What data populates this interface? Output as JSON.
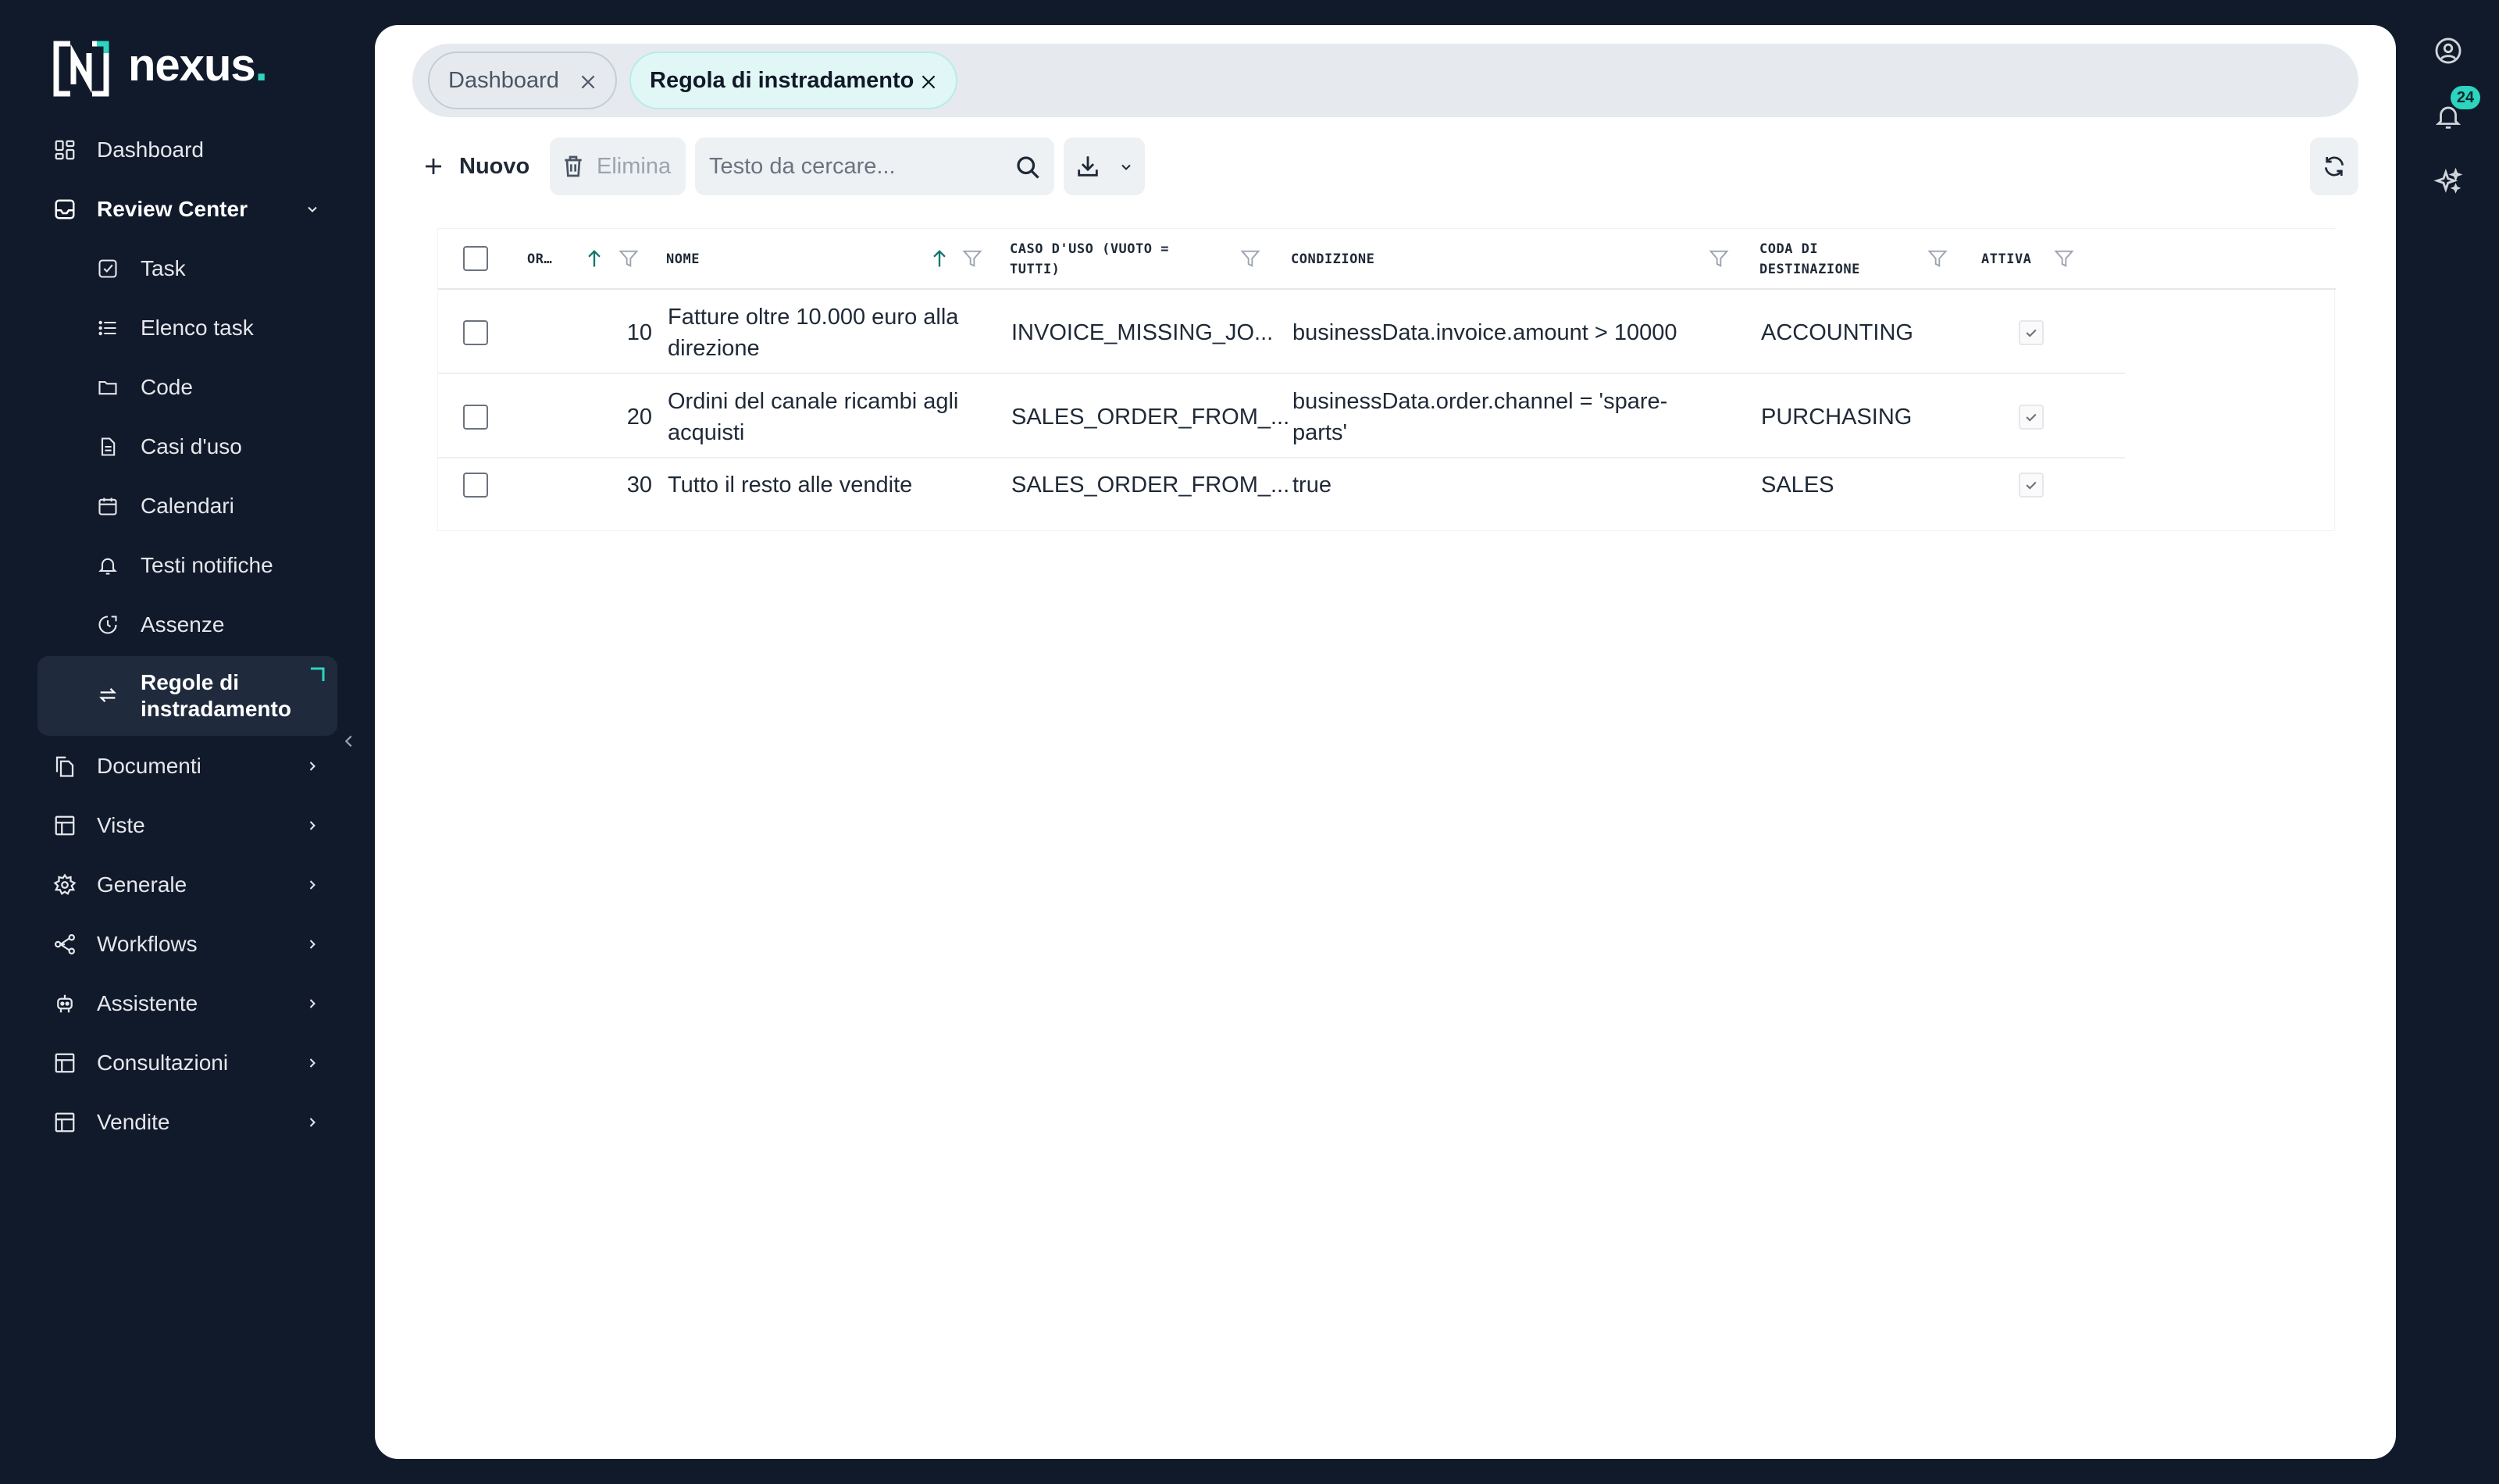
{
  "brand": {
    "name": "nexus",
    "dot": ".",
    "accent": "#2dd4bf"
  },
  "sidebar": {
    "items": [
      {
        "label": "Dashboard",
        "icon": "dashboard-icon"
      },
      {
        "label": "Review Center",
        "icon": "inbox-icon",
        "expanded": true
      },
      {
        "label": "Task",
        "icon": "task-check-icon"
      },
      {
        "label": "Elenco task",
        "icon": "list-icon"
      },
      {
        "label": "Code",
        "icon": "folder-icon"
      },
      {
        "label": "Casi d'uso",
        "icon": "document-icon"
      },
      {
        "label": "Calendari",
        "icon": "calendar-icon"
      },
      {
        "label": "Testi notifiche",
        "icon": "bell-icon"
      },
      {
        "label": "Assenze",
        "icon": "clock-icon"
      },
      {
        "label": "Regole di instradamento",
        "icon": "arrows-swap-icon",
        "active": true
      },
      {
        "label": "Documenti",
        "icon": "files-icon"
      },
      {
        "label": "Viste",
        "icon": "table-icon"
      },
      {
        "label": "Generale",
        "icon": "gear-icon"
      },
      {
        "label": "Workflows",
        "icon": "share-icon"
      },
      {
        "label": "Assistente",
        "icon": "robot-icon"
      },
      {
        "label": "Consultazioni",
        "icon": "table-icon"
      },
      {
        "label": "Vendite",
        "icon": "table-icon"
      }
    ]
  },
  "tabs": [
    {
      "label": "Dashboard",
      "active": false
    },
    {
      "label": "Regola di instradamento",
      "active": true
    }
  ],
  "toolbar": {
    "new_label": "Nuovo",
    "delete_label": "Elimina",
    "search_placeholder": "Testo da cercare..."
  },
  "table": {
    "columns": [
      {
        "label": "OR…",
        "sorted": "asc"
      },
      {
        "label": "NOME",
        "sorted": "asc"
      },
      {
        "label": "CASO D'USO (VUOTO = TUTTI)"
      },
      {
        "label": "CONDIZIONE"
      },
      {
        "label": "CODA DI DESTINAZIONE"
      },
      {
        "label": "ATTIVA"
      }
    ],
    "rows": [
      {
        "order": "10",
        "name": "Fatture oltre 10.000 euro alla direzione",
        "use_case": "INVOICE_MISSING_JO...",
        "condition": "businessData.invoice.amount > 10000",
        "queue": "ACCOUNTING",
        "active": true
      },
      {
        "order": "20",
        "name": "Ordini del canale ricambi agli acquisti",
        "use_case": "SALES_ORDER_FROM_...",
        "condition": "businessData.order.channel = 'spare-parts'",
        "queue": "PURCHASING",
        "active": true
      },
      {
        "order": "30",
        "name": "Tutto il resto alle vendite",
        "use_case": "SALES_ORDER_FROM_...",
        "condition": "true",
        "queue": "SALES",
        "active": true
      }
    ]
  },
  "header_right": {
    "notifications_count": "24"
  }
}
